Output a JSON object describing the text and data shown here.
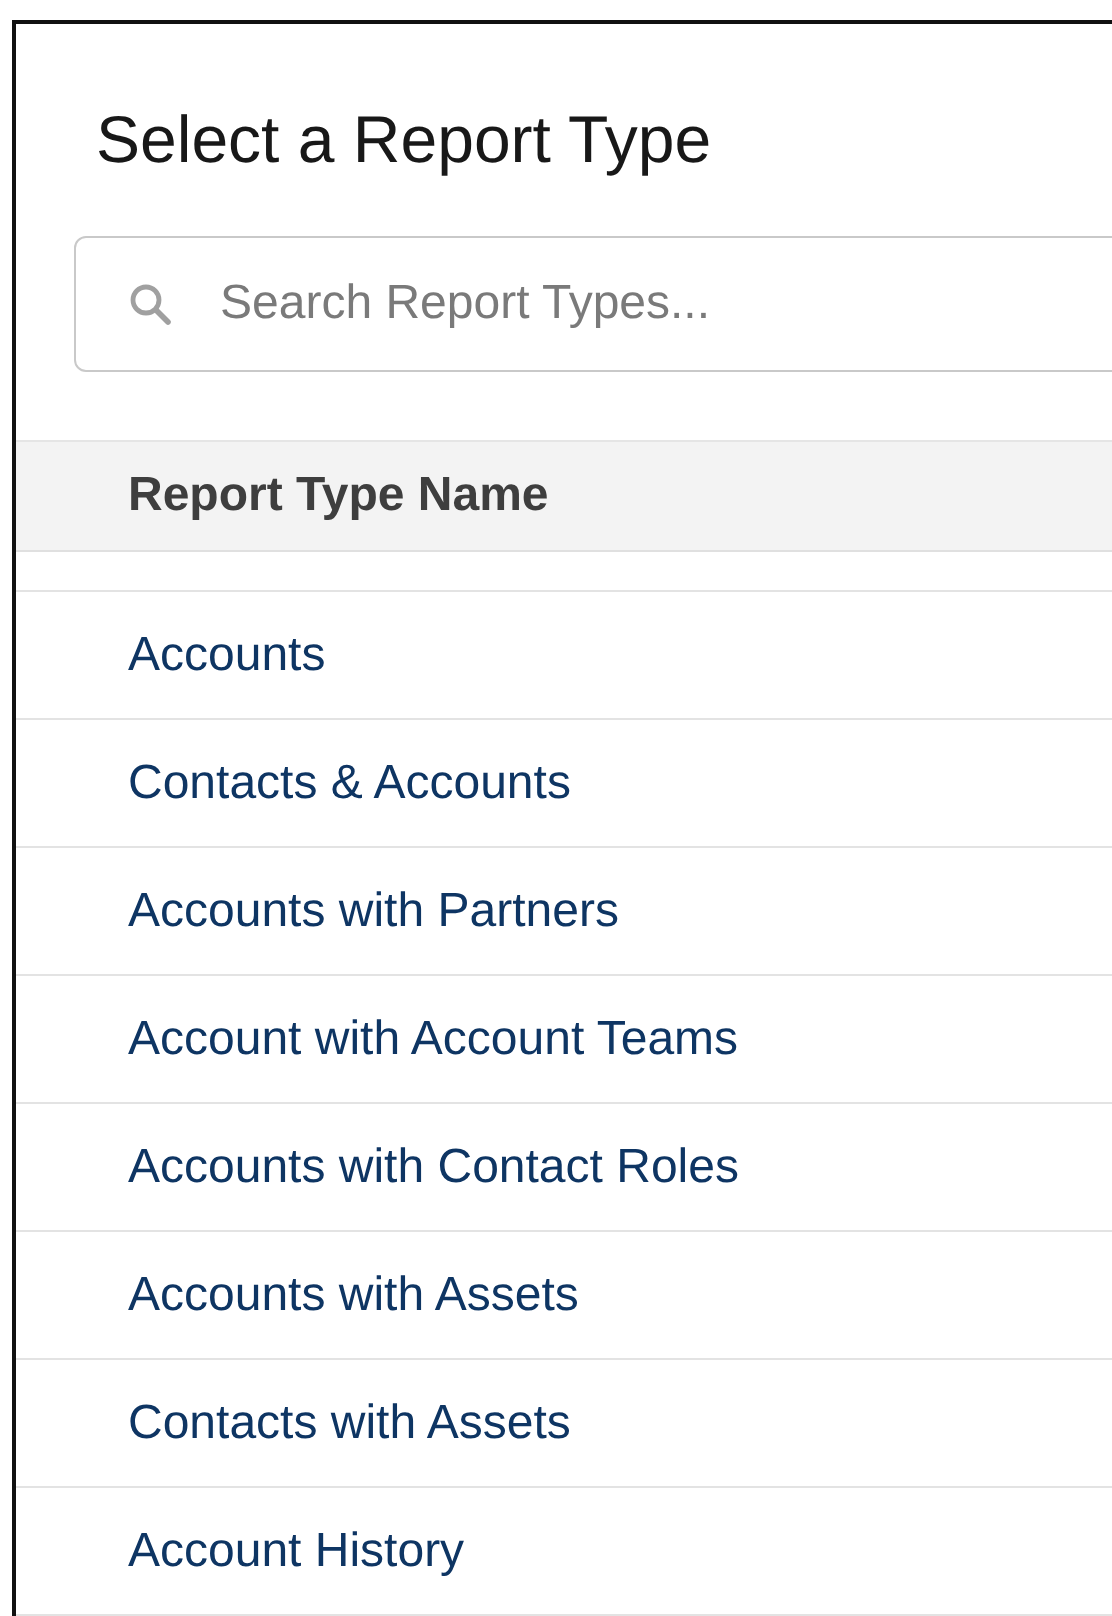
{
  "dialog": {
    "title": "Select a Report Type"
  },
  "search": {
    "placeholder": "Search Report Types..."
  },
  "table": {
    "columns": [
      "Report Type Name"
    ],
    "rows": [
      {
        "name": "Accounts"
      },
      {
        "name": "Contacts & Accounts"
      },
      {
        "name": "Accounts with Partners"
      },
      {
        "name": "Account with Account Teams"
      },
      {
        "name": "Accounts with Contact Roles"
      },
      {
        "name": "Accounts with Assets"
      },
      {
        "name": "Contacts with Assets"
      },
      {
        "name": "Account History"
      }
    ]
  }
}
